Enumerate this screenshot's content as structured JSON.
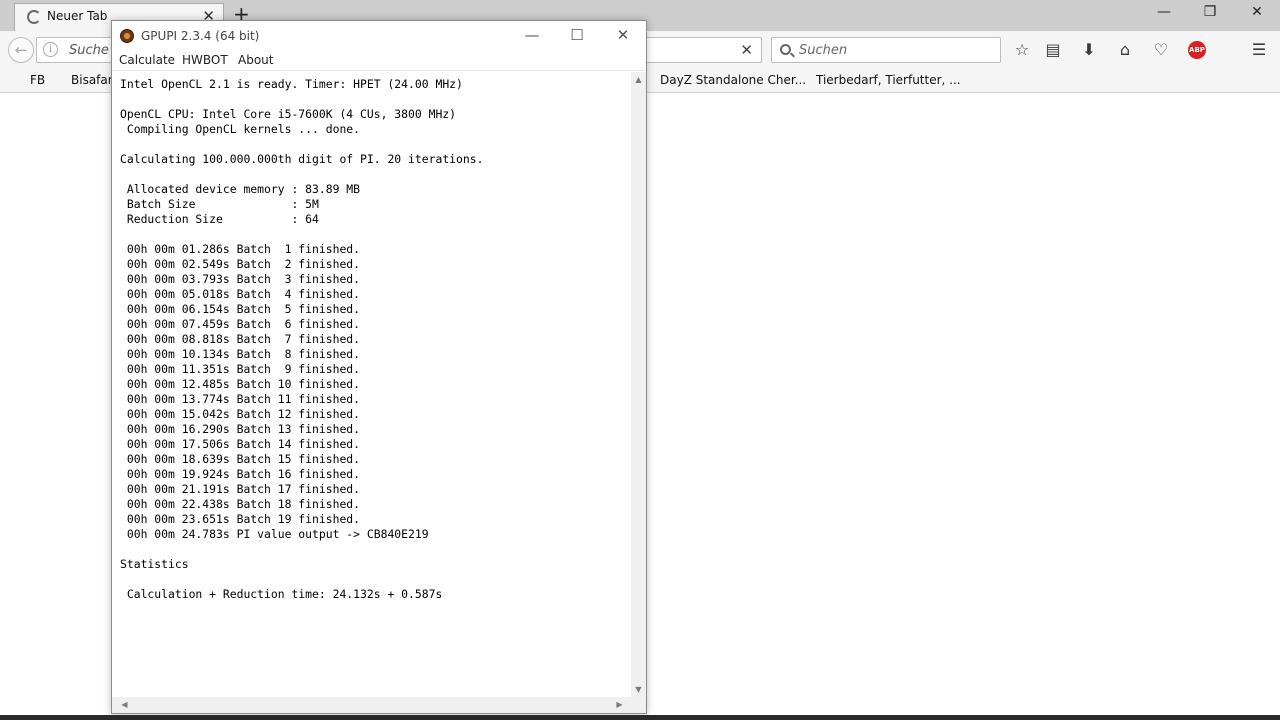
{
  "browser": {
    "tab_title": "Neuer Tab",
    "url_placeholder": "Suche oder Adresse eingeben",
    "search_placeholder": "Suchen",
    "bookmarks": [
      "FB",
      "Bisafans",
      "DayZ Standalone Cher...",
      "Tierbedarf, Tierfutter, ..."
    ],
    "abp_label": "ABP"
  },
  "app": {
    "title": "GPUPI 2.3.4 (64 bit)",
    "menu": [
      "Calculate",
      "HWBOT",
      "About"
    ],
    "console": [
      "Intel OpenCL 2.1 is ready. Timer: HPET (24.00 MHz)",
      "",
      "OpenCL CPU: Intel Core i5-7600K (4 CUs, 3800 MHz)",
      " Compiling OpenCL kernels ... done.",
      "",
      "Calculating 100.000.000th digit of PI. 20 iterations.",
      "",
      " Allocated device memory : 83.89 MB",
      " Batch Size              : 5M",
      " Reduction Size          : 64",
      "",
      " 00h 00m 01.286s Batch  1 finished.",
      " 00h 00m 02.549s Batch  2 finished.",
      " 00h 00m 03.793s Batch  3 finished.",
      " 00h 00m 05.018s Batch  4 finished.",
      " 00h 00m 06.154s Batch  5 finished.",
      " 00h 00m 07.459s Batch  6 finished.",
      " 00h 00m 08.818s Batch  7 finished.",
      " 00h 00m 10.134s Batch  8 finished.",
      " 00h 00m 11.351s Batch  9 finished.",
      " 00h 00m 12.485s Batch 10 finished.",
      " 00h 00m 13.774s Batch 11 finished.",
      " 00h 00m 15.042s Batch 12 finished.",
      " 00h 00m 16.290s Batch 13 finished.",
      " 00h 00m 17.506s Batch 14 finished.",
      " 00h 00m 18.639s Batch 15 finished.",
      " 00h 00m 19.924s Batch 16 finished.",
      " 00h 00m 21.191s Batch 17 finished.",
      " 00h 00m 22.438s Batch 18 finished.",
      " 00h 00m 23.651s Batch 19 finished.",
      " 00h 00m 24.783s PI value output -> CB840E219",
      "",
      "Statistics",
      "",
      " Calculation + Reduction time: 24.132s + 0.587s"
    ]
  },
  "icons": {
    "back": "arrow-left-icon",
    "info": "info-icon",
    "clear": "close-icon",
    "search": "search-icon",
    "bookmark_star": "star-icon",
    "reader": "reader-list-icon",
    "download": "download-arrow-icon",
    "home": "home-icon",
    "pocket": "pocket-icon",
    "menu": "hamburger-menu-icon"
  }
}
